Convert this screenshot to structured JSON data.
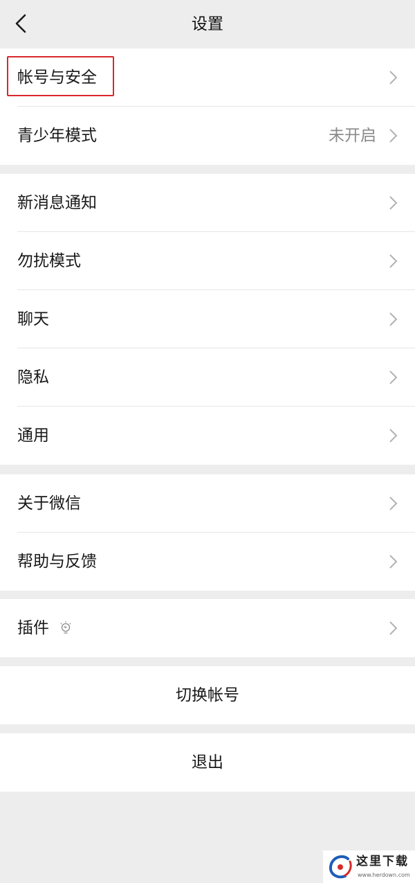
{
  "header": {
    "title": "设置",
    "back_icon": "chevron-left-icon"
  },
  "groups": [
    {
      "items": [
        {
          "label": "帐号与安全",
          "highlighted": true,
          "highlight_color": "#d8262c"
        },
        {
          "label": "青少年模式",
          "value": "未开启"
        }
      ]
    },
    {
      "items": [
        {
          "label": "新消息通知"
        },
        {
          "label": "勿扰模式"
        },
        {
          "label": "聊天"
        },
        {
          "label": "隐私"
        },
        {
          "label": "通用"
        }
      ]
    },
    {
      "items": [
        {
          "label": "关于微信"
        },
        {
          "label": "帮助与反馈"
        }
      ]
    },
    {
      "items": [
        {
          "label": "插件",
          "icon": "lightbulb-icon"
        }
      ]
    }
  ],
  "actions": {
    "switch_account": "切换帐号",
    "logout": "退出"
  },
  "watermark": {
    "text": "这里下载",
    "url": "www.herdown.com"
  },
  "colors": {
    "background": "#ededed",
    "row_background": "#ffffff",
    "secondary_text": "#8a8a8a",
    "chevron": "#b2b2b2",
    "highlight": "#d8262c"
  }
}
